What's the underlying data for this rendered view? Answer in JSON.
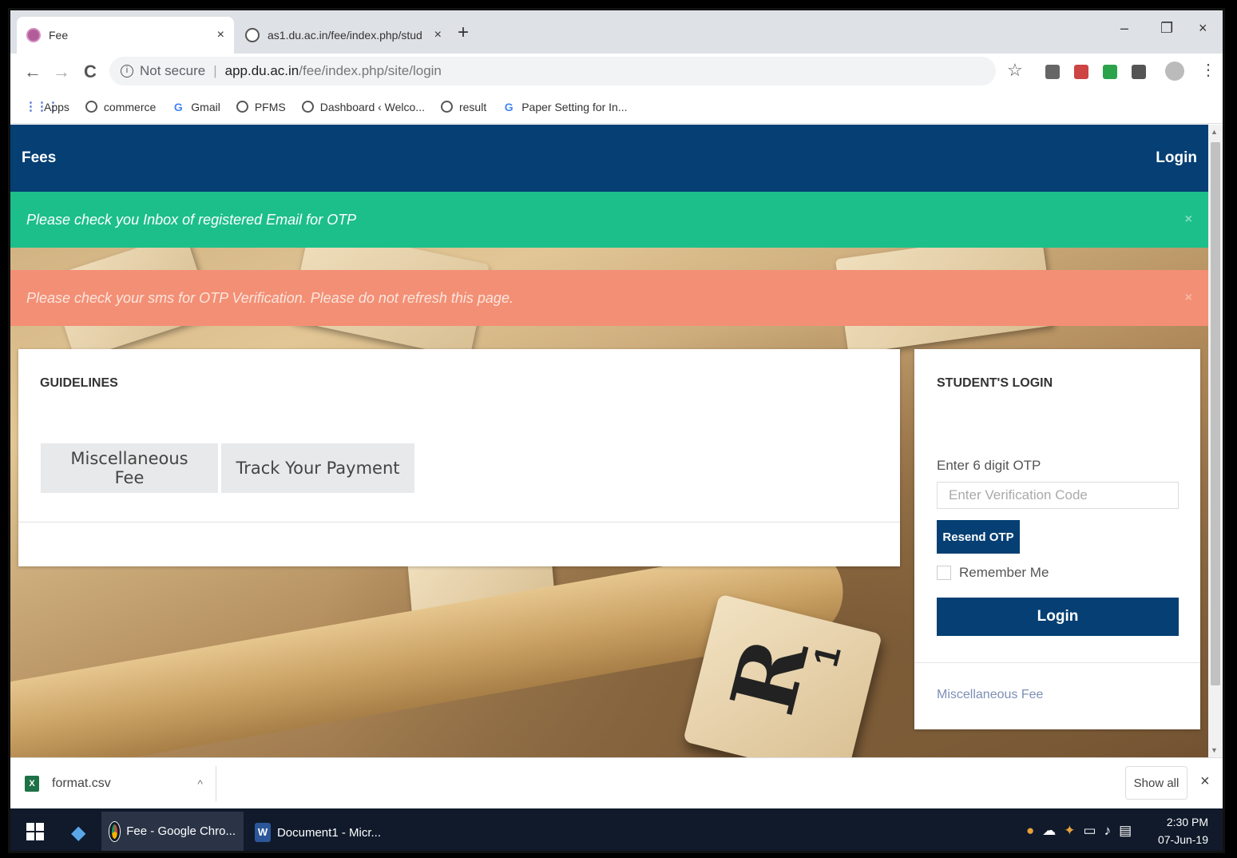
{
  "browser": {
    "tabs": [
      {
        "title": "Fee",
        "close": "×"
      },
      {
        "title": "as1.du.ac.in/fee/index.php/stud",
        "close": "×"
      }
    ],
    "new_tab": "+",
    "window_controls": {
      "minimize": "–",
      "restore": "❐",
      "close": "×"
    },
    "nav": {
      "back": "←",
      "forward": "→",
      "reload": "C"
    },
    "omnibox": {
      "security": "Not secure",
      "host": "app.du.ac.in",
      "path": "/fee/index.php/site/login"
    },
    "bookmarks": [
      {
        "label": "Apps",
        "icon": "apps-grid-icon"
      },
      {
        "label": "commerce",
        "icon": "globe-icon"
      },
      {
        "label": "Gmail",
        "icon": "google-icon"
      },
      {
        "label": "PFMS",
        "icon": "globe-icon"
      },
      {
        "label": "Dashboard ‹ Welco...",
        "icon": "globe-icon"
      },
      {
        "label": "result",
        "icon": "globe-icon"
      },
      {
        "label": "Paper Setting for In...",
        "icon": "google-icon"
      }
    ]
  },
  "page": {
    "navbar": {
      "brand": "Fees",
      "login": "Login"
    },
    "alerts": {
      "success": "Please check you Inbox of registered Email for OTP",
      "warning": "Please check your sms for OTP Verification. Please do not refresh this page.",
      "dismiss": "×"
    },
    "guidelines": {
      "title": "GUIDELINES",
      "buttons": [
        "Miscellaneous Fee",
        "Track Your Payment"
      ]
    },
    "student_login": {
      "title": "STUDENT'S LOGIN",
      "otp_label": "Enter 6 digit OTP",
      "otp_placeholder": "Enter Verification Code",
      "resend_label": "Resend OTP",
      "remember_label": "Remember Me",
      "login_label": "Login",
      "footer_link": "Miscellaneous Fee"
    },
    "background_tile": {
      "letter": "R",
      "score": "1"
    }
  },
  "download_bar": {
    "file": "format.csv",
    "file_icon_text": "X",
    "caret": "^",
    "show_all": "Show all",
    "close": "×"
  },
  "taskbar": {
    "items": [
      {
        "label": "Fee - Google Chro..."
      },
      {
        "label": "Document1 - Micr...",
        "icon_text": "W"
      }
    ],
    "time": "2:30 PM",
    "date": "07-Jun-19"
  },
  "colors": {
    "navbar": "#053f73",
    "success_alert": "#1cbf8a",
    "warning_alert": "#f38f75",
    "primary_button": "#053f73"
  }
}
